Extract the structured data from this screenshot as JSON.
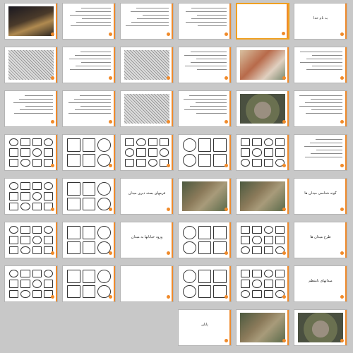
{
  "app": {
    "view": "Slide Sorter"
  },
  "accent_color": "#f08a2a",
  "selected_slide": 5,
  "slides": [
    {
      "n": 1,
      "kind": "photo-night"
    },
    {
      "n": 2,
      "kind": "text"
    },
    {
      "n": 3,
      "kind": "text"
    },
    {
      "n": 4,
      "kind": "text"
    },
    {
      "n": 5,
      "kind": "title",
      "title": ""
    },
    {
      "n": 6,
      "kind": "title",
      "title": "به نام خدا"
    },
    {
      "n": 7,
      "kind": "photo-sketch"
    },
    {
      "n": 8,
      "kind": "text"
    },
    {
      "n": 9,
      "kind": "photo-sketch"
    },
    {
      "n": 10,
      "kind": "text"
    },
    {
      "n": 11,
      "kind": "photo-city"
    },
    {
      "n": 12,
      "kind": "text"
    },
    {
      "n": 13,
      "kind": "text"
    },
    {
      "n": 14,
      "kind": "text"
    },
    {
      "n": 15,
      "kind": "photo-sketch"
    },
    {
      "n": 16,
      "kind": "text"
    },
    {
      "n": 17,
      "kind": "photo-plaza"
    },
    {
      "n": 18,
      "kind": "text"
    },
    {
      "n": 19,
      "kind": "diagram"
    },
    {
      "n": 20,
      "kind": "diagram"
    },
    {
      "n": 21,
      "kind": "diagram"
    },
    {
      "n": 22,
      "kind": "diagram"
    },
    {
      "n": 23,
      "kind": "diagram"
    },
    {
      "n": 24,
      "kind": "text"
    },
    {
      "n": 25,
      "kind": "diagram"
    },
    {
      "n": 26,
      "kind": "diagram"
    },
    {
      "n": 27,
      "kind": "title",
      "title": "فرمهای بسته دیری میدان"
    },
    {
      "n": 28,
      "kind": "photo-aerial"
    },
    {
      "n": 29,
      "kind": "photo-aerial"
    },
    {
      "n": 30,
      "kind": "title",
      "title": "گونه شناسی میدان ها"
    },
    {
      "n": 31,
      "kind": "diagram"
    },
    {
      "n": 32,
      "kind": "diagram"
    },
    {
      "n": 33,
      "kind": "title",
      "title": "ورود خیابانها به میدان"
    },
    {
      "n": 34,
      "kind": "diagram"
    },
    {
      "n": 35,
      "kind": "diagram"
    },
    {
      "n": 36,
      "kind": "title",
      "title": "طرح میدان ها"
    },
    {
      "n": 37,
      "kind": "diagram"
    },
    {
      "n": 38,
      "kind": "diagram"
    },
    {
      "n": 39,
      "kind": "title",
      "title": ""
    },
    {
      "n": 40,
      "kind": "diagram"
    },
    {
      "n": 41,
      "kind": "diagram"
    },
    {
      "n": 42,
      "kind": "title",
      "title": "میدانهای نامنظم"
    },
    {
      "n": 43,
      "kind": "title",
      "title": "پایان"
    },
    {
      "n": 44,
      "kind": "photo-aerial"
    },
    {
      "n": 45,
      "kind": "photo-plaza"
    }
  ]
}
